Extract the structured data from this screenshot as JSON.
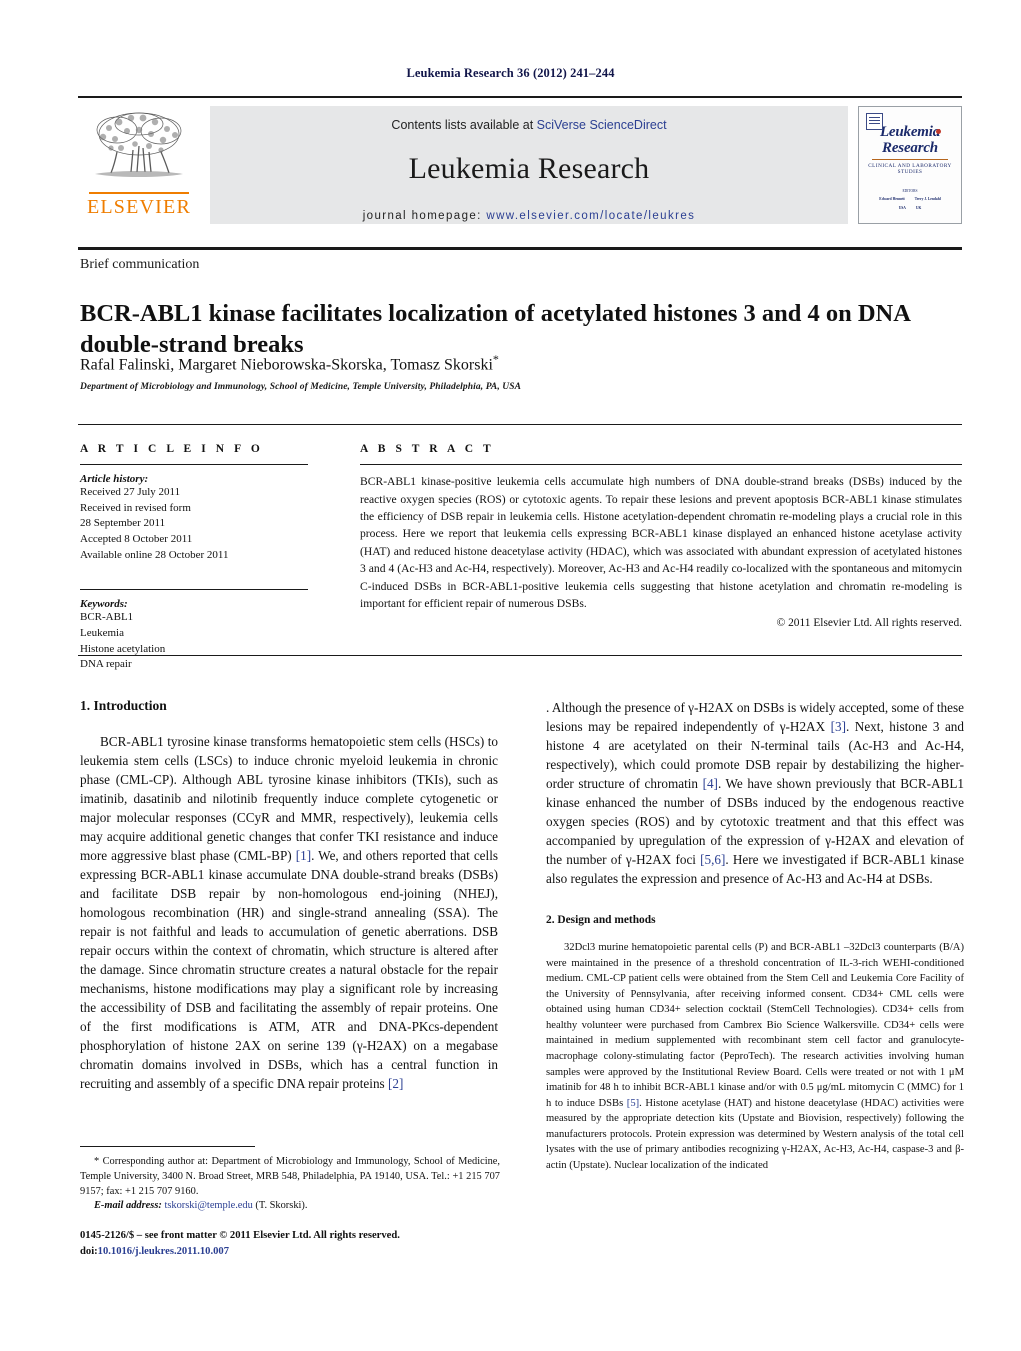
{
  "running_head": "Leukemia Research 36 (2012) 241–244",
  "masthead": {
    "contents_prefix": "Contents lists available at ",
    "contents_link": "SciVerse ScienceDirect",
    "journal_name": "Leukemia Research",
    "homepage_prefix": "journal homepage: ",
    "homepage_url": "www.elsevier.com/locate/leukres",
    "publisher_wordmark": "ELSEVIER",
    "publisher_color": "#ef7d00",
    "link_color": "#2b3f92"
  },
  "cover": {
    "title_line1": "Leukemia",
    "title_line2": "Research",
    "subtitle": "CLINICAL AND LABORATORY STUDIES",
    "editors_label": "EDITORS",
    "editor_1": "Edward Henneit",
    "editor_1_loc": "USA",
    "editor_2": "Terry J. Lendahl",
    "editor_2_loc": "UK"
  },
  "article": {
    "doctype": "Brief communication",
    "title": "BCR-ABL1 kinase facilitates localization of acetylated histones 3 and 4 on DNA double-strand breaks",
    "authors": "Rafal Falinski, Margaret Nieborowska-Skorska, Tomasz Skorski",
    "corresponding_marker": "*",
    "affiliation": "Department of Microbiology and Immunology, School of Medicine, Temple University, Philadelphia, PA, USA"
  },
  "article_info": {
    "heading": "A R T I C L E  I N F O",
    "history_label": "Article history:",
    "history": [
      "Received 27 July 2011",
      "Received in revised form",
      "28 September 2011",
      "Accepted 8 October 2011",
      "Available online 28 October 2011"
    ],
    "keywords_label": "Keywords:",
    "keywords": [
      "BCR-ABL1",
      "Leukemia",
      "Histone acetylation",
      "DNA repair"
    ]
  },
  "abstract": {
    "heading": "A B S T R A C T",
    "text": "BCR-ABL1 kinase-positive leukemia cells accumulate high numbers of DNA double-strand breaks (DSBs) induced by the reactive oxygen species (ROS) or cytotoxic agents. To repair these lesions and prevent apoptosis BCR-ABL1 kinase stimulates the efficiency of DSB repair in leukemia cells. Histone acetylation-dependent chromatin re-modeling plays a crucial role in this process. Here we report that leukemia cells expressing BCR-ABL1 kinase displayed an enhanced histone acetylase activity (HAT) and reduced histone deacetylase activity (HDAC), which was associated with abundant expression of acetylated histones 3 and 4 (Ac-H3 and Ac-H4, respectively). Moreover, Ac-H3 and Ac-H4 readily co-localized with the spontaneous and mitomycin C-induced DSBs in BCR-ABL1-positive leukemia cells suggesting that histone acetylation and chromatin re-modeling is important for efficient repair of numerous DSBs.",
    "copyright": "© 2011 Elsevier Ltd. All rights reserved."
  },
  "sections": {
    "intro_heading": "1. Introduction",
    "intro_p1_a": "BCR-ABL1 tyrosine kinase transforms hematopoietic stem cells (HSCs) to leukemia stem cells (LSCs) to induce chronic myeloid leukemia in chronic phase (CML-CP). Although ABL tyrosine kinase inhibitors (TKIs), such as imatinib, dasatinib and nilotinib frequently induce complete cytogenetic or major molecular responses (CCyR and MMR, respectively), leukemia cells may acquire additional genetic changes that confer TKI resistance and induce more aggressive blast phase (CML-BP) ",
    "intro_ref1": "[1]",
    "intro_p1_b": ". We, and others reported that cells expressing BCR-ABL1 kinase accumulate DNA double-strand breaks (DSBs) and facilitate DSB repair by non-homologous end-joining (NHEJ), homologous recombination (HR) and single-strand annealing (SSA). The repair is not faithful and leads to accumulation of genetic aberrations. DSB repair occurs within the context of chromatin, which structure is altered after the damage. Since chromatin structure creates a natural obstacle for the repair mechanisms, histone modifications may play a significant role by increasing the accessibility of DSB and facilitating the assembly of repair proteins. One of the first modifications is ATM, ATR and DNA-PKcs-dependent phosphorylation of histone 2AX on serine 139 (γ-H2AX) on a megabase chromatin domains involved in DSBs, which has a central function in recruiting and assembly of a specific DNA repair proteins ",
    "intro_ref2": "[2]",
    "intro_p1_c": ". Although the presence of γ-H2AX on DSBs is widely accepted, some of these lesions may be repaired independently of γ-H2AX ",
    "intro_ref3": "[3]",
    "intro_p1_d": ". Next, histone 3 and histone 4 are acetylated on their N-terminal tails (Ac-H3 and Ac-H4, respectively), which could promote DSB repair by destabilizing the higher-order structure of chromatin ",
    "intro_ref4": "[4]",
    "intro_p1_e": ". We have shown previously that BCR-ABL1 kinase enhanced the number of DSBs induced by the endogenous reactive oxygen species (ROS) and by cytotoxic treatment and that this effect was accompanied by upregulation of the expression of γ-H2AX and elevation of the number of γ-H2AX foci ",
    "intro_ref5": "[5,6]",
    "intro_p1_f": ". Here we investigated if BCR-ABL1 kinase also regulates the expression and presence of Ac-H3 and Ac-H4 at DSBs.",
    "methods_heading": "2. Design and methods",
    "methods_p1_a": "32Dcl3 murine hematopoietic parental cells (P) and BCR-ABL1 –32Dcl3 counterparts (B/A) were maintained in the presence of a threshold concentration of IL-3-rich WEHI-conditioned medium. CML-CP patient cells were obtained from the Stem Cell and Leukemia Core Facility of the University of Pennsylvania, after receiving informed consent. CD34+ CML cells were obtained using human CD34+ selection cocktail (StemCell Technologies). CD34+ cells from healthy volunteer were purchased from Cambrex Bio Science Walkersville. CD34+ cells were maintained in medium supplemented with recombinant stem cell factor and granulocyte-macrophage colony-stimulating factor (PeproTech). The research activities involving human samples were approved by the Institutional Review Board. Cells were treated or not with 1 μM imatinib for 48 h to inhibit BCR-ABL1 kinase and/or with 0.5 μg/mL mitomycin C (MMC) for 1 h to induce DSBs ",
    "methods_ref5": "[5]",
    "methods_p1_b": ". Histone acetylase (HAT) and histone deacetylase (HDAC) activities were measured by the appropriate detection kits (Upstate and Biovision, respectively) following the manufacturers protocols. Protein expression was determined by Western analysis of the total cell lysates with the use of primary antibodies recognizing γ-H2AX, Ac-H3, Ac-H4, caspase-3 and β-actin (Upstate). Nuclear localization of the indicated"
  },
  "footnote": {
    "marker": "*",
    "text": " Corresponding author at: Department of Microbiology and Immunology, School of Medicine, Temple University, 3400 N. Broad Street, MRB 548, Philadelphia, PA 19140, USA. Tel.: +1 215 707 9157; fax: +1 215 707 9160.",
    "email_label": "E-mail address:",
    "email": "tskorski@temple.edu",
    "email_owner": " (T. Skorski)."
  },
  "colophon": {
    "front_matter": "0145-2126/$ – see front matter © 2011 Elsevier Ltd. All rights reserved.",
    "doi_label": "doi:",
    "doi_value": "10.1016/j.leukres.2011.10.007"
  }
}
